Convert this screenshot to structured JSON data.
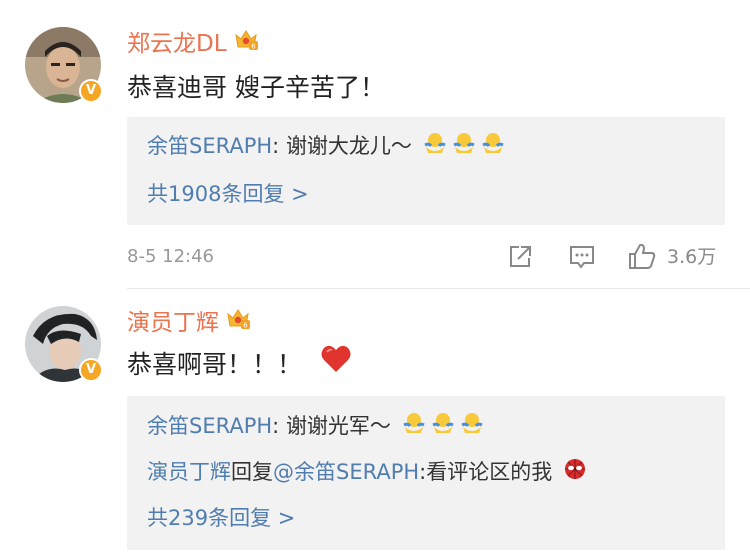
{
  "comments": [
    {
      "username": "郑云龙DL",
      "text": "恭喜迪哥 嫂子辛苦了！",
      "reply_preview": {
        "author": "余笛SERAPH",
        "text": "谢谢大龙儿～"
      },
      "reply_count_text": "共1908条回复 >",
      "timestamp": "8-5 12:46",
      "likes": "3.6万"
    },
    {
      "username": "演员丁辉",
      "text": "恭喜啊哥！！！",
      "reply_preview": {
        "author": "余笛SERAPH",
        "text": "谢谢光军～"
      },
      "reply_second": {
        "author": "演员丁辉",
        "reply_word": "回复",
        "mention": "@余笛SERAPH",
        "text": "看评论区的我"
      },
      "reply_count_text": "共239条回复 >"
    }
  ],
  "colors": {
    "username": "#eb7350",
    "link": "#507daf",
    "reply_bg": "#f2f2f2",
    "verify": "#f5a623",
    "heart": "#e0342e"
  },
  "icons": [
    "crown-badge-icon",
    "verified-icon",
    "share-icon",
    "comment-icon",
    "like-icon",
    "heart-emoji",
    "hug-emoji",
    "spider-emoji"
  ],
  "separator": ": "
}
